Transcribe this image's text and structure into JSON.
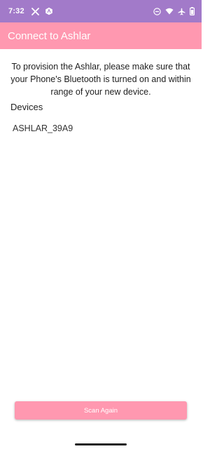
{
  "status_bar": {
    "time": "7:32",
    "left_icons": [
      "x-logo-icon",
      "app-notification-icon"
    ],
    "right_icons": [
      "do-not-disturb-icon",
      "wifi-icon",
      "airplane-icon",
      "battery-icon"
    ]
  },
  "app_bar": {
    "title": "Connect to Ashlar"
  },
  "main": {
    "instructions": "To provision the Ashlar, please make sure that your Phone's Bluetooth is turned on and within range of your new device.",
    "devices_heading": "Devices",
    "devices": [
      {
        "name": "ASHLAR_39A9"
      }
    ]
  },
  "footer": {
    "scan_again_label": "Scan Again"
  },
  "colors": {
    "status_bar": "#a27ac9",
    "accent": "#ff98b0"
  }
}
